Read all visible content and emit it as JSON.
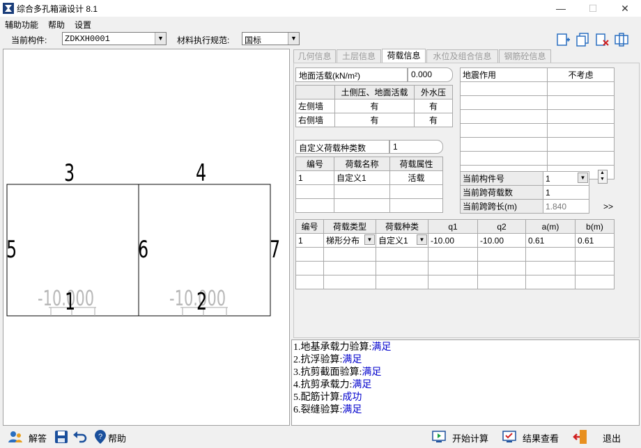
{
  "window": {
    "title": "综合多孔箱涵设计 8.1",
    "controls": [
      "—",
      "☐",
      "✕"
    ]
  },
  "menu": {
    "items": [
      "辅助功能",
      "帮助",
      "设置"
    ]
  },
  "toolbar": {
    "component_label": "当前构件:",
    "component_value": "ZDKXH0001",
    "standard_label": "材料执行规范:",
    "standard_value": "国标"
  },
  "drawing": {
    "top_labels": [
      "3",
      "4"
    ],
    "side_labels": [
      "5",
      "6",
      "7"
    ],
    "bottom_labels": [
      "1",
      "2"
    ],
    "load_labels": [
      "-10.000",
      "-10.000"
    ]
  },
  "tabs": [
    {
      "label": "几何信息",
      "active": false
    },
    {
      "label": "土层信息",
      "active": false
    },
    {
      "label": "荷载信息",
      "active": true
    },
    {
      "label": "水位及组合信息",
      "active": false
    },
    {
      "label": "钢筋砼信息",
      "active": false
    }
  ],
  "load": {
    "ground_live_label": "地面活载(kN/m²)",
    "ground_live_value": "0.000",
    "wall_table": {
      "headers": [
        "",
        "土侧压、地面活载",
        "外水压"
      ],
      "rows": [
        [
          "左侧墙",
          "有",
          "有"
        ],
        [
          "右侧墙",
          "有",
          "有"
        ]
      ]
    },
    "seismic": {
      "label": "地震作用",
      "value": "不考虑"
    },
    "custom_count_label": "自定义荷载种类数",
    "custom_count_value": "1",
    "custom_table": {
      "headers": [
        "编号",
        "荷载名称",
        "荷载属性"
      ],
      "rows": [
        [
          "1",
          "自定义1",
          "活载"
        ]
      ]
    },
    "span": {
      "component_no_label": "当前构件号",
      "component_no_value": "1",
      "load_count_label": "当前跨荷载数",
      "load_count_value": "1",
      "span_length_label": "当前跨跨长(m)",
      "span_length_value": "1.840",
      "spin_up": "▲",
      "spin_down": "▼",
      "more": ">>"
    },
    "load_table": {
      "headers": [
        "编号",
        "荷载类型",
        "荷载种类",
        "q1",
        "q2",
        "a(m)",
        "b(m)"
      ],
      "rows": [
        [
          "1",
          "梯形分布",
          "自定义1",
          "-10.00",
          "-10.00",
          "0.61",
          "0.61"
        ]
      ]
    }
  },
  "results": [
    {
      "name": "1.地基承载力验算:",
      "status": "满足"
    },
    {
      "name": "2.抗浮验算:",
      "status": "满足"
    },
    {
      "name": "3.抗剪截面验算:",
      "status": "满足"
    },
    {
      "name": "4.抗剪承载力:",
      "status": "满足"
    },
    {
      "name": "5.配筋计算:",
      "status": "成功"
    },
    {
      "name": "6.裂缝验算:",
      "status": "满足"
    }
  ],
  "bottom": {
    "answer": "解答",
    "help": "帮助",
    "start": "开始计算",
    "view": "结果查看",
    "exit": "退出"
  }
}
